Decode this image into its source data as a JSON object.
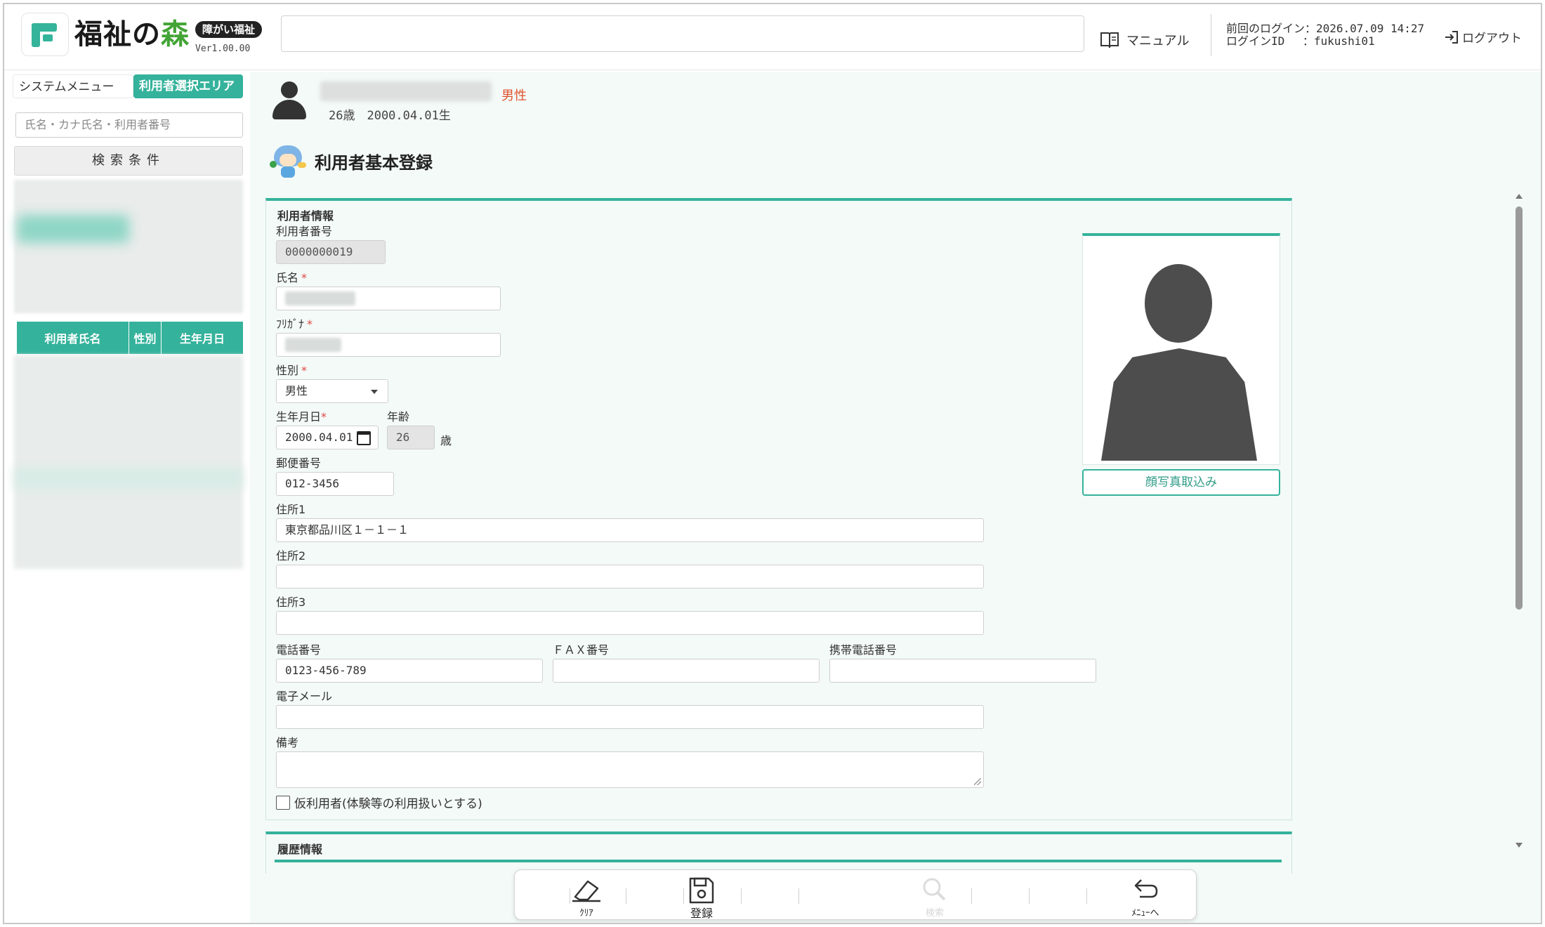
{
  "header": {
    "brand_part1": "福祉の",
    "brand_part2": "森",
    "badge": "障がい福祉",
    "version": "Ver1.00.00",
    "manual_label": "マニュアル",
    "last_login_line": "前回のログイン：2026.07.09 14:27",
    "login_id_line": "ログインID　 ：fukushi01",
    "logout_label": "ログアウト"
  },
  "sidebar": {
    "tab_system": "システムメニュー",
    "tab_user_area": "利用者選択エリア",
    "search_placeholder": "氏名・カナ氏名・利用者番号",
    "search_condition_button": "検索条件",
    "table_headers": [
      "利用者氏名",
      "性別",
      "生年月日"
    ]
  },
  "banner": {
    "gender": "男性",
    "age_birth": "26歳　2000.04.01生"
  },
  "page": {
    "title": "利用者基本登録"
  },
  "form": {
    "section_title": "利用者情報",
    "user_number_label": "利用者番号",
    "user_number_value": "0000000019",
    "name_label": "氏名",
    "kana_label": "ﾌﾘｶﾞﾅ",
    "required_mark": "*",
    "gender_label": "性別",
    "gender_value": "男性",
    "birthdate_label": "生年月日",
    "birthdate_value": "2000.04.01",
    "age_label": "年齢",
    "age_value": "26",
    "age_unit": "歳",
    "postal_label": "郵便番号",
    "postal_value": "012-3456",
    "address1_label": "住所1",
    "address1_value": "東京都品川区１－１－１",
    "address2_label": "住所2",
    "address2_value": "",
    "address3_label": "住所3",
    "address3_value": "",
    "phone_label": "電話番号",
    "phone_value": "0123-456-789",
    "fax_label": "ＦＡＸ番号",
    "fax_value": "",
    "mobile_label": "携帯電話番号",
    "mobile_value": "",
    "email_label": "電子メール",
    "email_value": "",
    "notes_label": "備考",
    "temporary_user_label": "仮利用者(体験等の利用扱いとする)",
    "photo_button": "顔写真取込み"
  },
  "history": {
    "title": "履歴情報"
  },
  "toolbar": {
    "clear_label": "ｸﾘｱ",
    "register_label": "登録",
    "search_label": "検索",
    "menu_label": "ﾒﾆｭｰへ"
  },
  "colors": {
    "accent": "#35b29b",
    "brand_green": "#43a436",
    "gender_text": "#e0522d",
    "required": "#e04848"
  },
  "icons": {
    "manual": "book-icon",
    "logout": "logout-icon",
    "clear": "eraser-icon",
    "register": "save-icon",
    "search": "search-icon",
    "menu": "return-arrow-icon",
    "calendar": "calendar-icon"
  }
}
